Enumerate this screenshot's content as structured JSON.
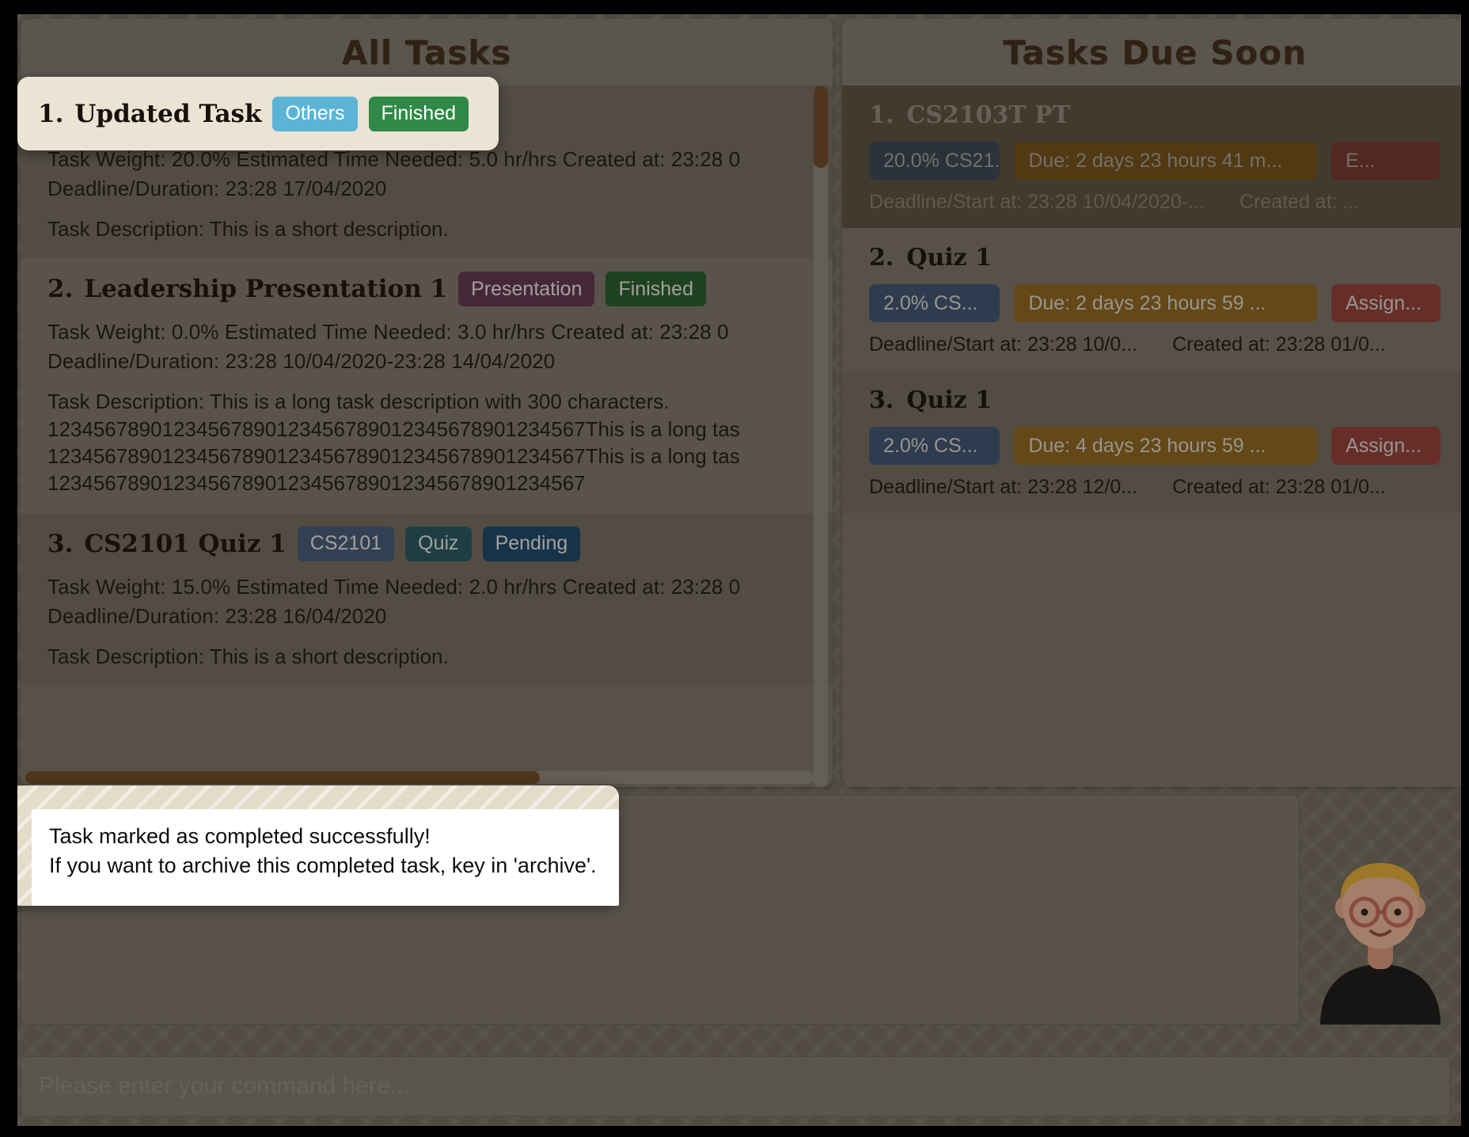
{
  "panels": {
    "all_tasks": {
      "title": "All Tasks"
    },
    "due_soon": {
      "title": "Tasks Due Soon"
    }
  },
  "all_tasks": [
    {
      "index": "1.",
      "title": "Updated Task",
      "badges": [
        {
          "label": "Others",
          "kind": "others"
        },
        {
          "label": "Finished",
          "kind": "finished"
        }
      ],
      "meta": "Task Weight: 20.0%   Estimated Time Needed: 5.0 hr/hrs   Created at: 23:28 0",
      "deadline": "Deadline/Duration: 23:28 17/04/2020",
      "description_lines": [
        "Task Description: This is a short description."
      ]
    },
    {
      "index": "2.",
      "title": "Leadership Presentation 1",
      "badges": [
        {
          "label": "Presentation",
          "kind": "presentation"
        },
        {
          "label": "Finished",
          "kind": "finished-d"
        }
      ],
      "meta": "Task Weight: 0.0%   Estimated Time Needed: 3.0 hr/hrs   Created at: 23:28 0",
      "deadline": "Deadline/Duration: 23:28 10/04/2020-23:28 14/04/2020",
      "description_lines": [
        "Task Description: This is a long task description with 300 characters.",
        "12345678901234567890123456789012345678901234567This is a long tas",
        "12345678901234567890123456789012345678901234567This is a long tas",
        "12345678901234567890123456789012345678901234567"
      ]
    },
    {
      "index": "3.",
      "title": "CS2101 Quiz 1",
      "badges": [
        {
          "label": "CS2101",
          "kind": "module"
        },
        {
          "label": "Quiz",
          "kind": "quiz"
        },
        {
          "label": "Pending",
          "kind": "pending"
        }
      ],
      "meta": "Task Weight: 15.0%   Estimated Time Needed: 2.0 hr/hrs   Created at: 23:28 0",
      "deadline": "Deadline/Duration: 23:28 16/04/2020",
      "description_lines": [
        "Task Description: This is a short description."
      ]
    }
  ],
  "due_soon": [
    {
      "index": "1.",
      "title": "CS2103T PT",
      "badges": [
        {
          "label": "20.0% CS21...",
          "kind": "mod"
        },
        {
          "label": "Due: 2 days 23 hours 41 m...",
          "kind": "due"
        },
        {
          "label": "E...",
          "kind": "tag"
        }
      ],
      "deadline": "Deadline/Start at: 23:28 10/04/2020-...",
      "created": "Created at: ..."
    },
    {
      "index": "2.",
      "title": "Quiz 1",
      "badges": [
        {
          "label": "2.0% CS...",
          "kind": "mod"
        },
        {
          "label": "Due: 2 days 23 hours 59 ...",
          "kind": "due"
        },
        {
          "label": "Assign...",
          "kind": "tag"
        }
      ],
      "deadline": "Deadline/Start at: 23:28 10/0...",
      "created": "Created at: 23:28 01/0..."
    },
    {
      "index": "3.",
      "title": "Quiz 1",
      "badges": [
        {
          "label": "2.0% CS...",
          "kind": "mod"
        },
        {
          "label": "Due: 4 days 23 hours 59 ...",
          "kind": "due"
        },
        {
          "label": "Assign...",
          "kind": "tag"
        }
      ],
      "deadline": "Deadline/Start at: 23:28 12/0...",
      "created": "Created at: 23:28 01/0..."
    }
  ],
  "highlight_task": {
    "index": "1.",
    "title": "Updated Task",
    "badges": [
      {
        "label": "Others",
        "kind": "others"
      },
      {
        "label": "Finished",
        "kind": "finished"
      }
    ]
  },
  "toast": {
    "line1": "Task marked as completed successfully!",
    "line2": "If you want to archive this completed task, key in 'archive'."
  },
  "command": {
    "placeholder": "Please enter your command here...",
    "value": ""
  },
  "avatar": {
    "name": "user-avatar"
  },
  "colors": {
    "accent_brown": "#6b4a2a",
    "panel": "#77736c",
    "title": "#3a2a1c",
    "highlight": "#ebe3d4"
  }
}
